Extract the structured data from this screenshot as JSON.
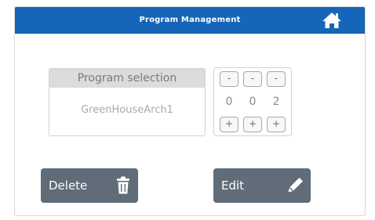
{
  "header": {
    "title": "Program Management",
    "background": "#1565b8",
    "home_icon": "home-icon"
  },
  "program_selection": {
    "heading": "Program selection",
    "selected_program": "GreenHouseArch1"
  },
  "stepper": {
    "minus_label": "-",
    "plus_label": "+",
    "digits": [
      "0",
      "0",
      "2"
    ]
  },
  "actions": {
    "delete_label": "Delete",
    "delete_icon": "trash-icon",
    "edit_label": "Edit",
    "edit_icon": "pencil-icon",
    "button_color": "#606c78"
  }
}
